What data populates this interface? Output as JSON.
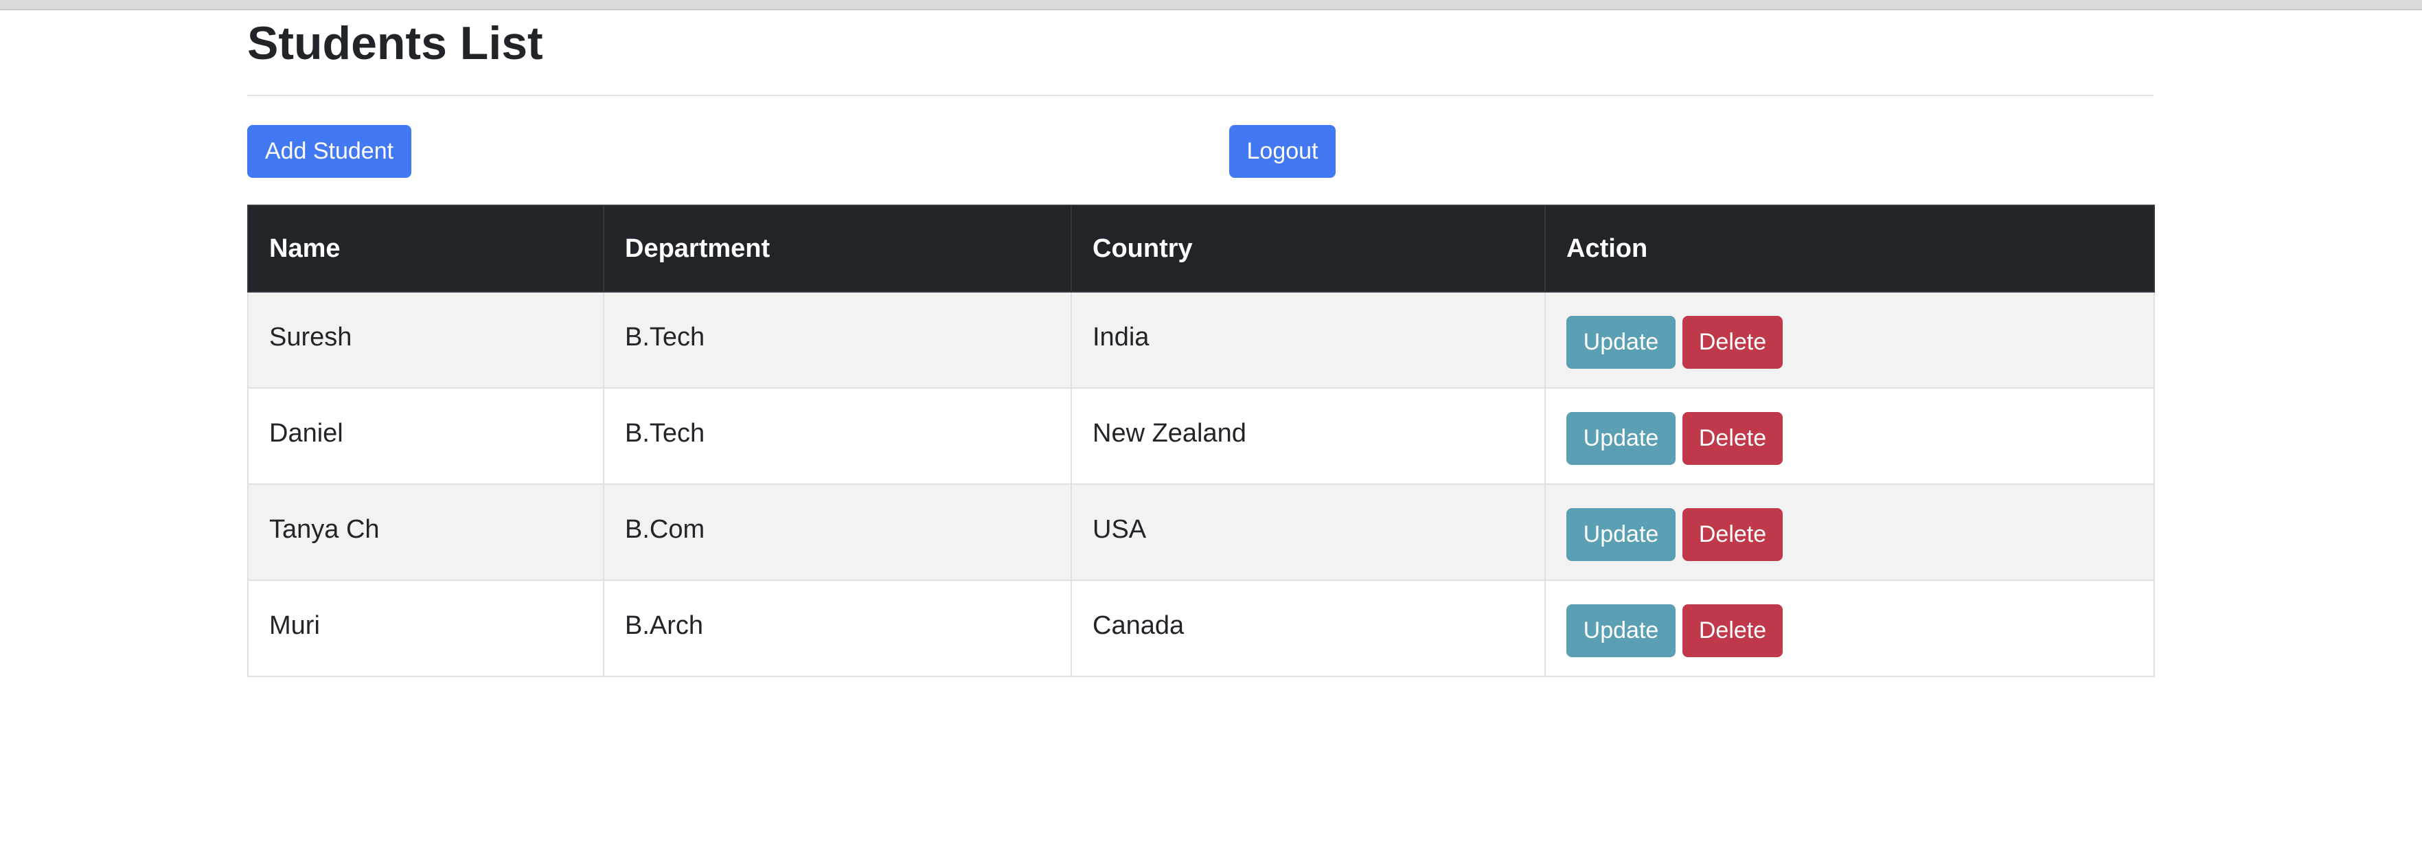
{
  "page": {
    "title": "Students List"
  },
  "toolbar": {
    "add_label": "Add Student",
    "logout_label": "Logout"
  },
  "table": {
    "headers": [
      "Name",
      "Department",
      "Country",
      "Action"
    ],
    "rows": [
      {
        "name": "Suresh",
        "department": "B.Tech",
        "country": "India",
        "update_label": "Update",
        "delete_label": "Delete"
      },
      {
        "name": "Daniel",
        "department": "B.Tech",
        "country": "New Zealand",
        "update_label": "Update",
        "delete_label": "Delete"
      },
      {
        "name": "Tanya Ch",
        "department": "B.Com",
        "country": "USA",
        "update_label": "Update",
        "delete_label": "Delete"
      },
      {
        "name": "Muri",
        "department": "B.Arch",
        "country": "Canada",
        "update_label": "Update",
        "delete_label": "Delete"
      }
    ]
  },
  "colors": {
    "primary": "#4279f2",
    "info": "#5a9fb3",
    "danger": "#c0394a",
    "header_bg": "#212529"
  }
}
